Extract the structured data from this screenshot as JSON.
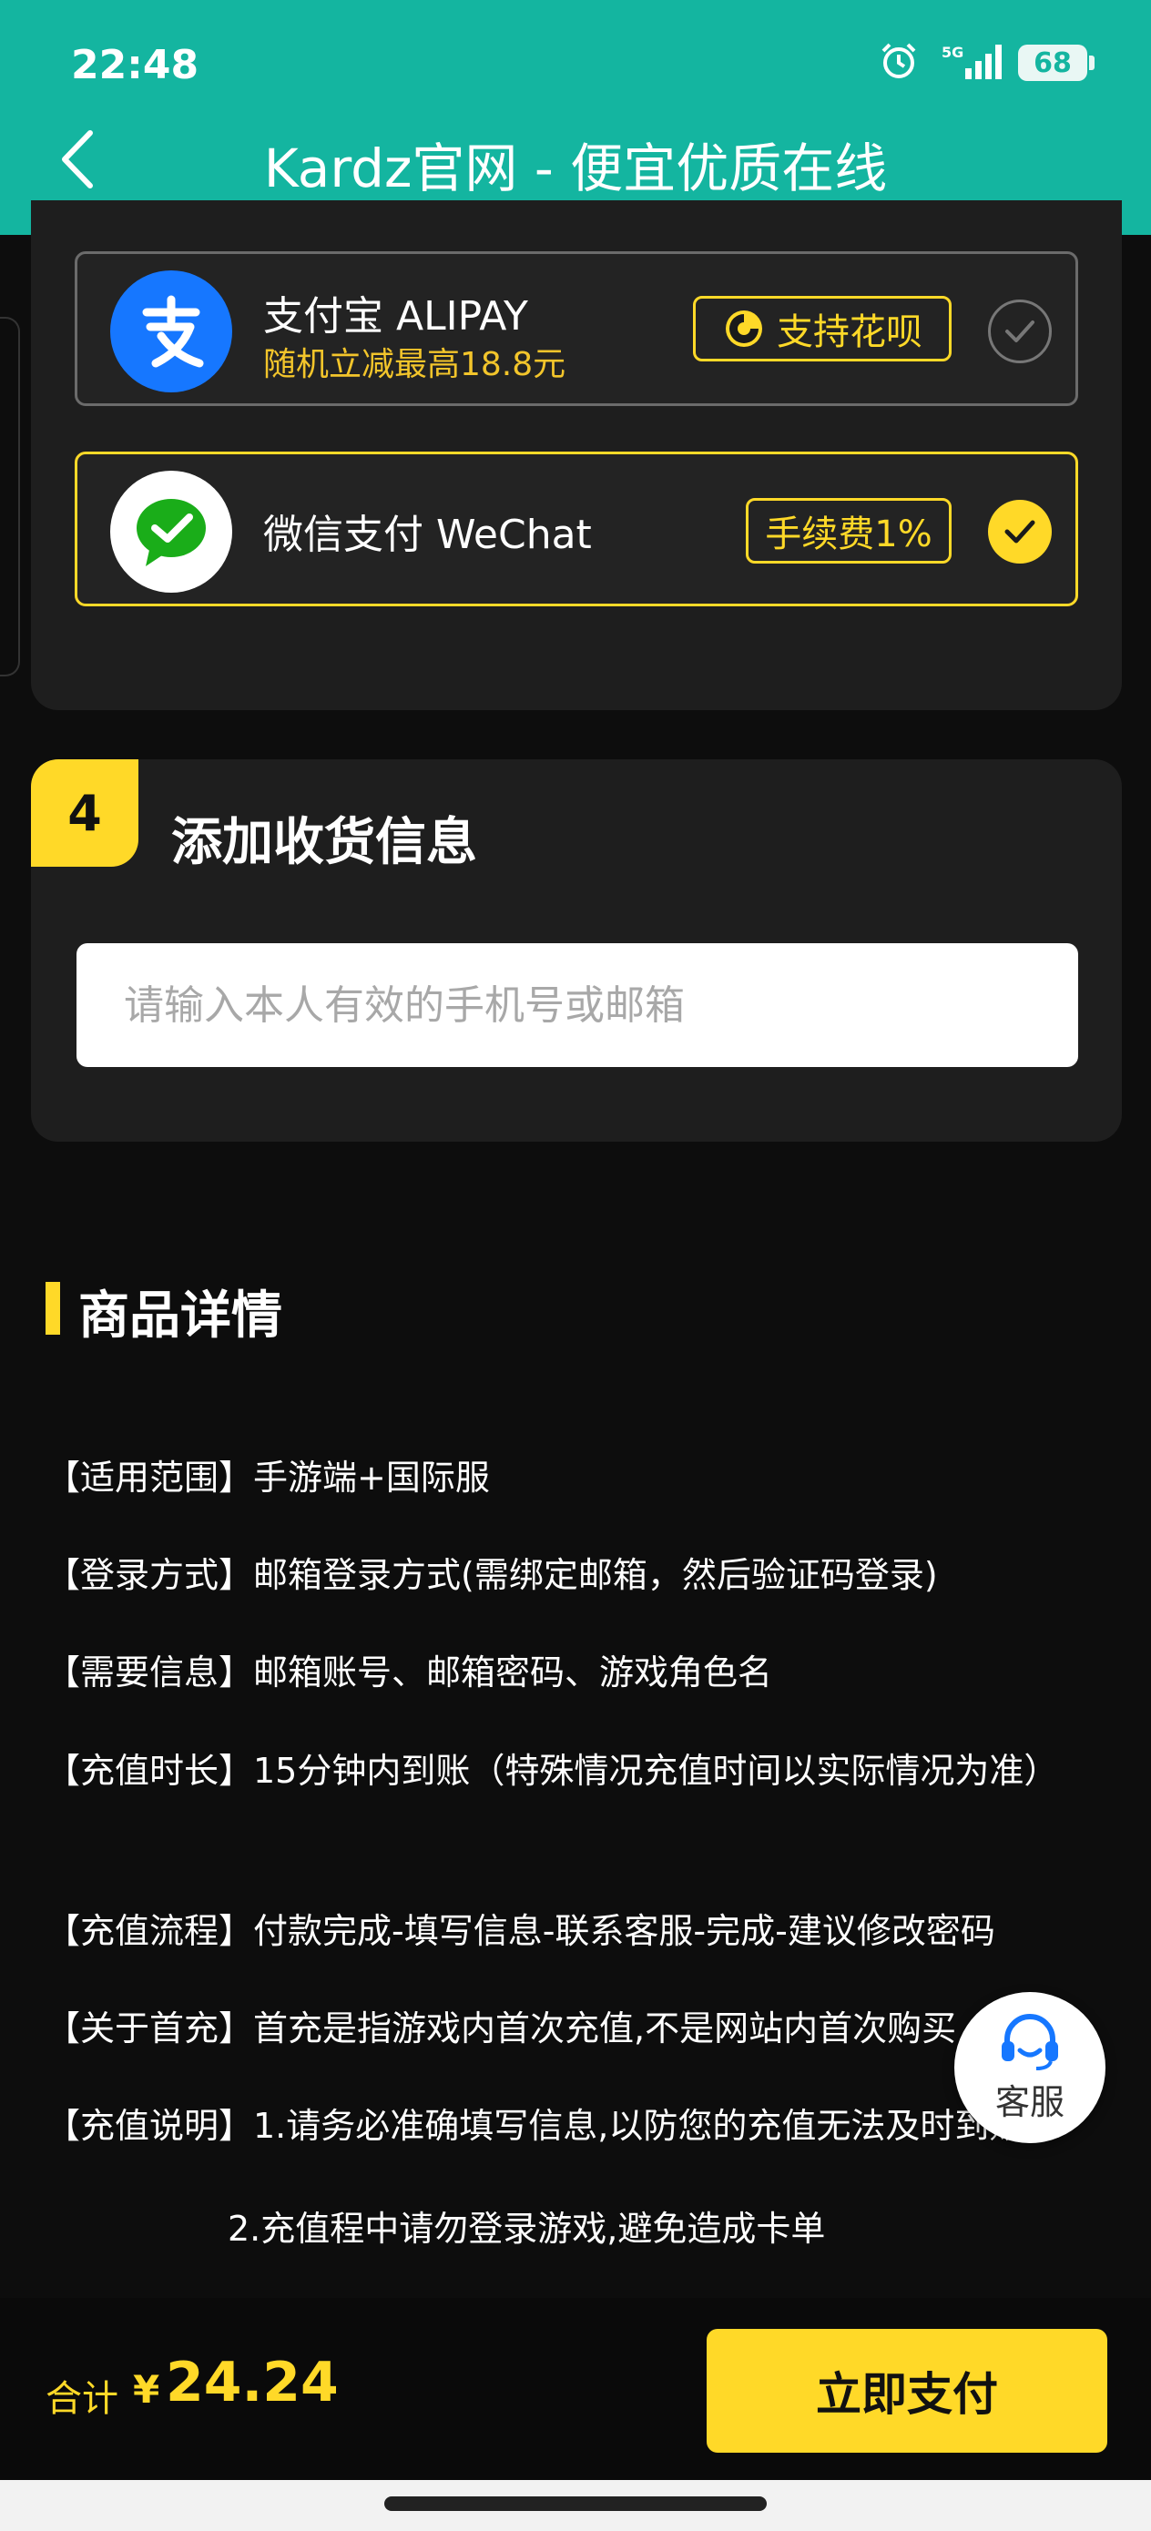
{
  "status_bar": {
    "time": "22:48",
    "network": "5G",
    "battery": "68"
  },
  "header": {
    "title": "Kardz官网 - 便宜优质在线"
  },
  "payment": {
    "alipay": {
      "name": "支付宝 ALIPAY",
      "subtitle": "随机立减最高18.8元",
      "tag": "支持花呗",
      "selected": false
    },
    "wechat": {
      "name": "微信支付 WeChat",
      "tag": "手续费1%",
      "selected": true
    }
  },
  "shipping": {
    "step": "4",
    "title": "添加收货信息",
    "placeholder": "请输入本人有效的手机号或邮箱"
  },
  "details": {
    "title": "商品详情",
    "lines": [
      "【适用范围】手游端+国际服",
      "【登录方式】邮箱登录方式(需绑定邮箱，然后验证码登录)",
      "【需要信息】邮箱账号、邮箱密码、游戏角色名",
      "【充值时长】15分钟内到账（特殊情况充值时间以实际情况为准）",
      "【充值流程】付款完成-填写信息-联系客服-完成-建议修改密码",
      "【关于首充】首充是指游戏内首次充值,不是网站内首次购买",
      "【充值说明】1.请务必准确填写信息,以防您的充值无法及时到账",
      "2.充值程中请勿登录游戏,避免造成卡单"
    ]
  },
  "service": {
    "label": "客服"
  },
  "footer": {
    "total_label": "合计",
    "currency": "¥",
    "amount": "24.24",
    "pay_label": "立即支付"
  },
  "colors": {
    "header": "#14b5a0",
    "accent": "#ffd928",
    "background": "#0d0d0d",
    "card": "#1e1e1e"
  }
}
